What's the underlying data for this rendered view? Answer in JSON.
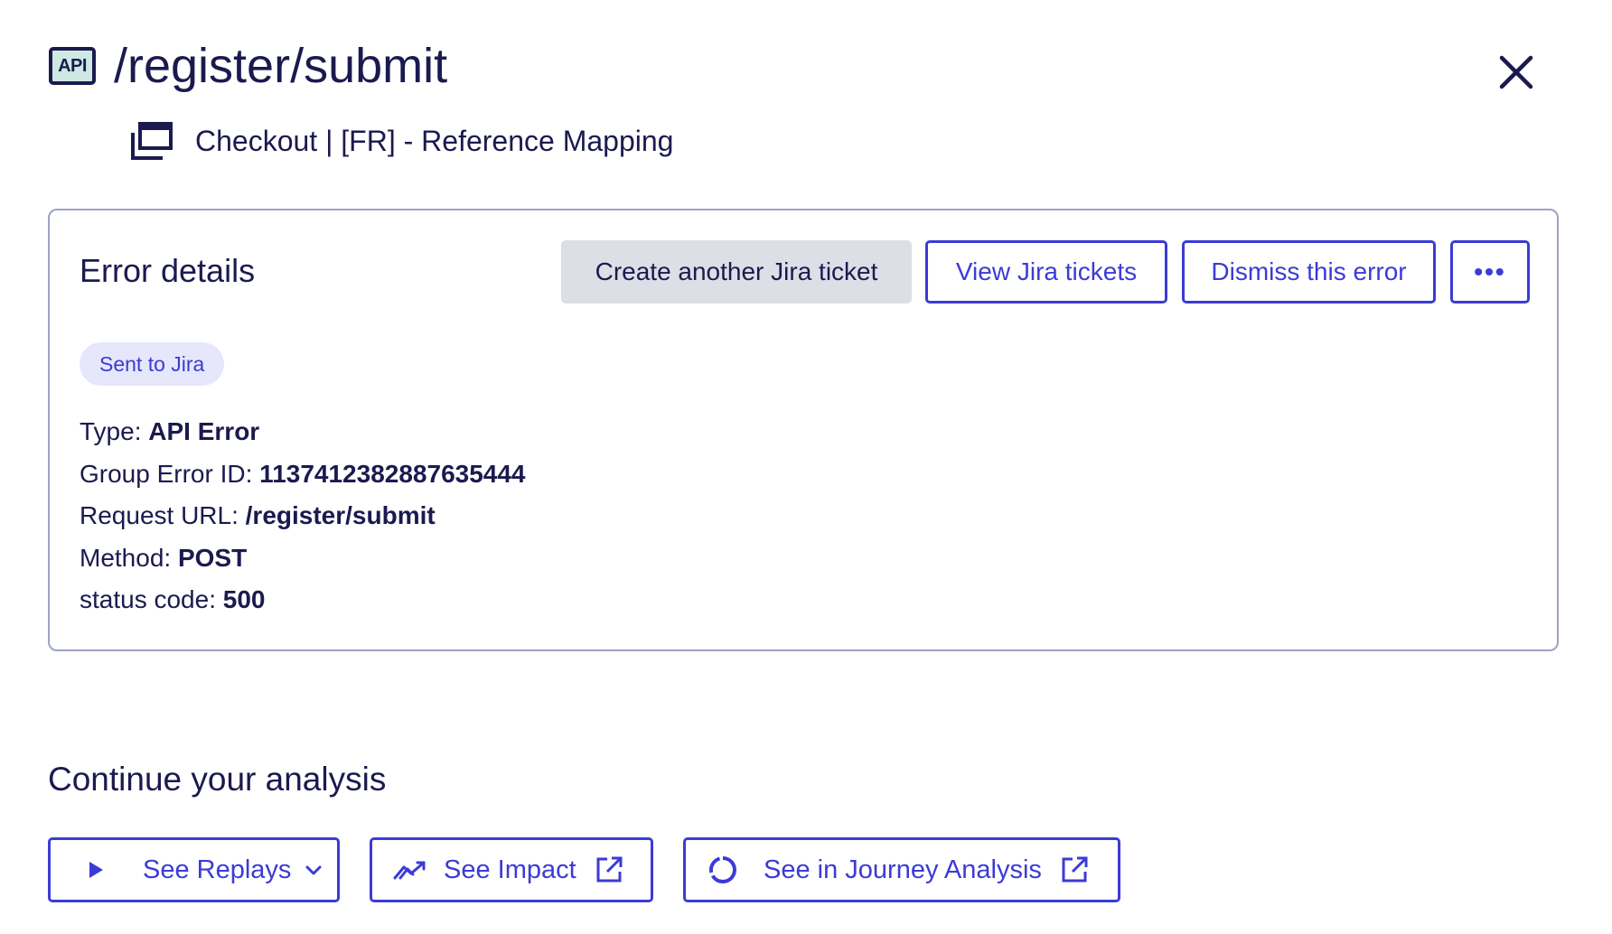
{
  "header": {
    "badge": "API",
    "title": "/register/submit",
    "subtitle": "Checkout | [FR] - Reference Mapping"
  },
  "icons": {
    "api": "api-badge-icon",
    "page": "page-stack-icon",
    "close": "close-icon",
    "play": "play-icon",
    "chevron": "chevron-down-icon",
    "impact": "trend-icon",
    "external": "external-link-icon",
    "journey": "circle-progress-icon"
  },
  "colors": {
    "primary": "#3b3bd6",
    "text": "#1b1a4f",
    "gray_button": "#dcdfe6",
    "tag_bg": "#e6e7fb",
    "badge_bg": "#cde9e2",
    "card_border": "#9da3c0"
  },
  "error_card": {
    "title": "Error details",
    "buttons": {
      "create": "Create another Jira ticket",
      "view": "View Jira tickets",
      "dismiss": "Dismiss this error",
      "more": "•••"
    },
    "tag": "Sent to Jira",
    "fields": [
      {
        "label": "Type:",
        "value": "API Error"
      },
      {
        "label": "Group Error ID:",
        "value": "1137412382887635444"
      },
      {
        "label": "Request URL:",
        "value": "/register/submit"
      },
      {
        "label": "Method:",
        "value": "POST"
      },
      {
        "label": "status code:",
        "value": "500"
      }
    ]
  },
  "analysis": {
    "title": "Continue your analysis",
    "actions": {
      "replays": "See Replays",
      "impact": "See Impact",
      "journey": "See in Journey Analysis"
    }
  }
}
